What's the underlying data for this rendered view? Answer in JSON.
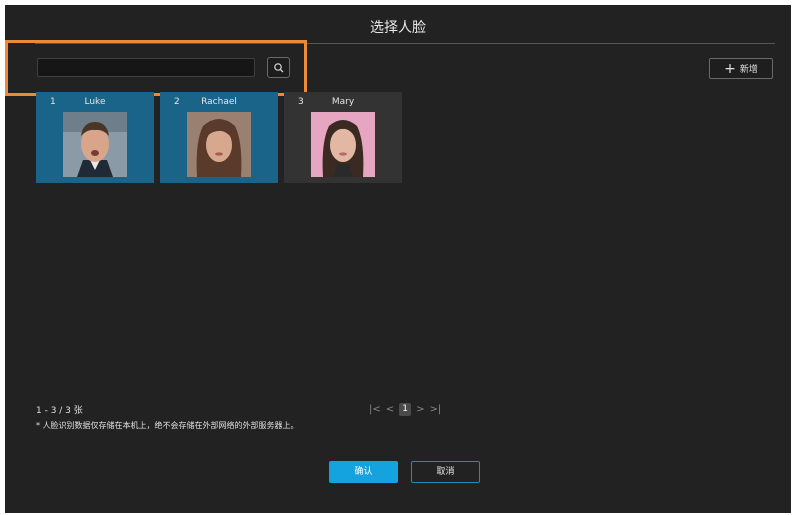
{
  "dialog": {
    "title": "选择人脸"
  },
  "search": {
    "value": "",
    "placeholder": ""
  },
  "toolbar": {
    "add_label": "新增",
    "add_icon": "plus-icon"
  },
  "faces": [
    {
      "index": "1",
      "name": "Luke",
      "selected": true
    },
    {
      "index": "2",
      "name": "Rachael",
      "selected": true
    },
    {
      "index": "3",
      "name": "Mary",
      "selected": false
    }
  ],
  "footer": {
    "count": "1 - 3 / 3 张",
    "note": "* 人脸识别数据仅存储在本机上，绝不会存储在外部网络的外部服务器上。"
  },
  "pagination": {
    "current_page": "1"
  },
  "actions": {
    "confirm_label": "确认",
    "cancel_label": "取消"
  },
  "colors": {
    "accent": "#15a3e0",
    "selected_card": "#1a6489",
    "highlight": "#e98b38"
  }
}
